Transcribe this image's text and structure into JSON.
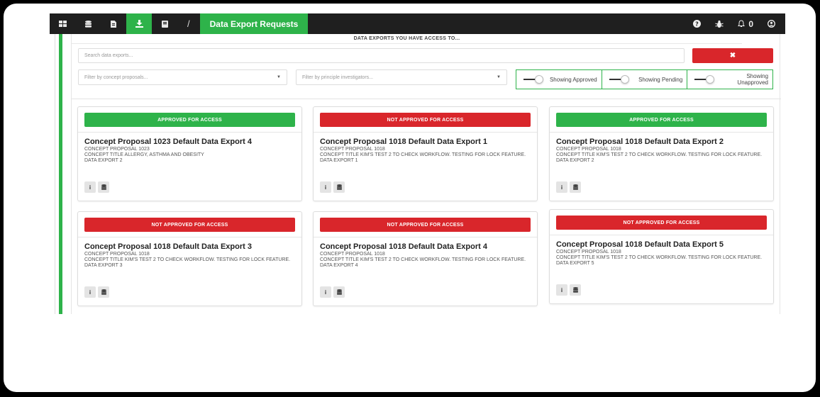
{
  "nav": {
    "icons": [
      "grid-icon",
      "database-icon",
      "file-icon",
      "download-icon",
      "book-icon"
    ],
    "separator": "/",
    "title": "Data Export Requests",
    "right": {
      "help_icon": "question-circle-icon",
      "bug_icon": "bug-icon",
      "notifications_icon": "bell-icon",
      "notifications_count": "0",
      "user_icon": "user-circle-icon"
    }
  },
  "filters": {
    "heading": "DATA EXPORTS YOU HAVE ACCESS TO...",
    "search_placeholder": "Search data exports...",
    "clear_icon": "✖",
    "concept_placeholder": "Filter by concept proposals...",
    "investigator_placeholder": "Filter by principle investigators...",
    "toggles": [
      {
        "label": "Showing Approved"
      },
      {
        "label": "Showing Pending"
      },
      {
        "label": "Showing Unapproved"
      }
    ]
  },
  "colors": {
    "green": "#2eb34a",
    "red": "#d9262b",
    "nav_bg": "#1f1f1f"
  },
  "cards": [
    {
      "status": "APPROVED FOR ACCESS",
      "approved": true,
      "title": "Concept Proposal 1023 Default Data Export 4",
      "lines": [
        "CONCEPT PROPOSAL 1023",
        "CONCEPT TITLE ALLERGY, ASTHMA AND OBESITY",
        "DATA EXPORT 2"
      ]
    },
    {
      "status": "NOT APPROVED FOR ACCESS",
      "approved": false,
      "title": "Concept Proposal 1018 Default Data Export 1",
      "lines": [
        "CONCEPT PROPOSAL 1018",
        "CONCEPT TITLE KIM'S TEST 2 TO CHECK WORKFLOW. TESTING FOR LOCK FEATURE.",
        "DATA EXPORT 1"
      ]
    },
    {
      "status": "APPROVED FOR ACCESS",
      "approved": true,
      "title": "Concept Proposal 1018 Default Data Export 2",
      "lines": [
        "CONCEPT PROPOSAL 1018",
        "CONCEPT TITLE KIM'S TEST 2 TO CHECK WORKFLOW. TESTING FOR LOCK FEATURE.",
        "DATA EXPORT 2"
      ]
    },
    {
      "status": "NOT APPROVED FOR ACCESS",
      "approved": false,
      "title": "Concept Proposal 1018 Default Data Export 3",
      "lines": [
        "CONCEPT PROPOSAL 1018",
        "CONCEPT TITLE KIM'S TEST 2 TO CHECK WORKFLOW. TESTING FOR LOCK FEATURE.",
        "DATA EXPORT 3"
      ]
    },
    {
      "status": "NOT APPROVED FOR ACCESS",
      "approved": false,
      "title": "Concept Proposal 1018 Default Data Export 4",
      "lines": [
        "CONCEPT PROPOSAL 1018",
        "CONCEPT TITLE KIM'S TEST 2 TO CHECK WORKFLOW. TESTING FOR LOCK FEATURE.",
        "DATA EXPORT 4"
      ]
    },
    {
      "status": "NOT APPROVED FOR ACCESS",
      "approved": false,
      "title": "Concept Proposal 1018 Default Data Export 5",
      "lines": [
        "CONCEPT PROPOSAL 1018",
        "CONCEPT TITLE KIM'S TEST 2 TO CHECK WORKFLOW. TESTING FOR LOCK FEATURE.",
        "DATA EXPORT 5"
      ]
    }
  ],
  "card_actions": {
    "info_label": "i",
    "data_icon": "database-icon"
  }
}
